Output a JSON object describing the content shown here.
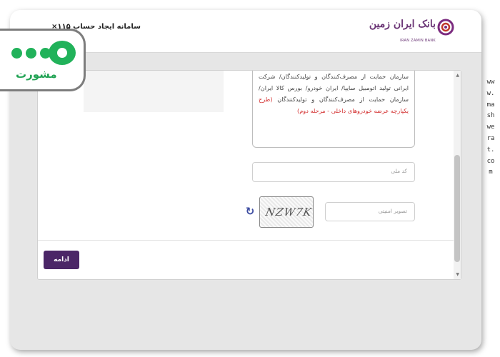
{
  "header": {
    "page_title": "سامانه ایجاد حساب ۱۱۵×",
    "bank_name_fa": "بانک ایران زمین",
    "bank_name_en": "IRAN ZAMIN BANK"
  },
  "terms": {
    "text_before": "سازمان حمایت از مصرف‌کنندگان و تولیدکنندگان/ شرکت ایرانی تولید اتومبیل سایپا/ ایران خودرو/ بورس کالا ایران/ سازمان حمایت از مصرف‌کنندگان و تولیدکنندگان ",
    "text_highlight": "(طرح یکپارچه عرضه خودروهای داخلی - مرحله دوم)"
  },
  "form": {
    "national_code_placeholder": "کد ملی",
    "captcha_placeholder": "تصویر امنیتی",
    "captcha_text": "NZW7K",
    "refresh_icon": "↻",
    "continue_label": "ادامه"
  },
  "badge": {
    "word": "مشورت"
  },
  "watermark": "www.mashwerat.com",
  "colors": {
    "brand_purple": "#4b2667",
    "badge_green": "#21b25a",
    "highlight_red": "#d32f2f"
  }
}
